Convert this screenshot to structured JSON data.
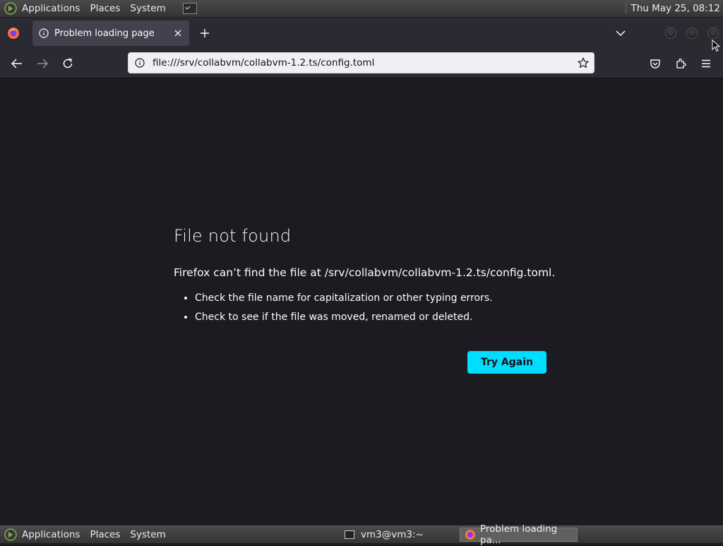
{
  "top_panel": {
    "menus": [
      "Applications",
      "Places",
      "System"
    ],
    "clock": "Thu May 25, 08:12"
  },
  "browser": {
    "tab_title": "Problem loading page",
    "url": "file:///srv/collabvm/collabvm-1.2.ts/config.toml"
  },
  "error_page": {
    "title": "File not found",
    "description": "Firefox can’t find the file at /srv/collabvm/collabvm-1.2.ts/config.toml.",
    "tips": [
      "Check the file name for capitalization or other typing errors.",
      "Check to see if the file was moved, renamed or deleted."
    ],
    "try_again_label": "Try Again"
  },
  "bottom_panel": {
    "menus": [
      "Applications",
      "Places",
      "System"
    ],
    "tasks": [
      {
        "label": "vm3@vm3:~",
        "icon": "terminal-icon"
      },
      {
        "label": "Problem loading pa...",
        "icon": "firefox-icon"
      }
    ]
  },
  "colors": {
    "page_background": "#1c1b22",
    "accent_button": "#00ddff",
    "toolbar": "#2b2a33"
  }
}
